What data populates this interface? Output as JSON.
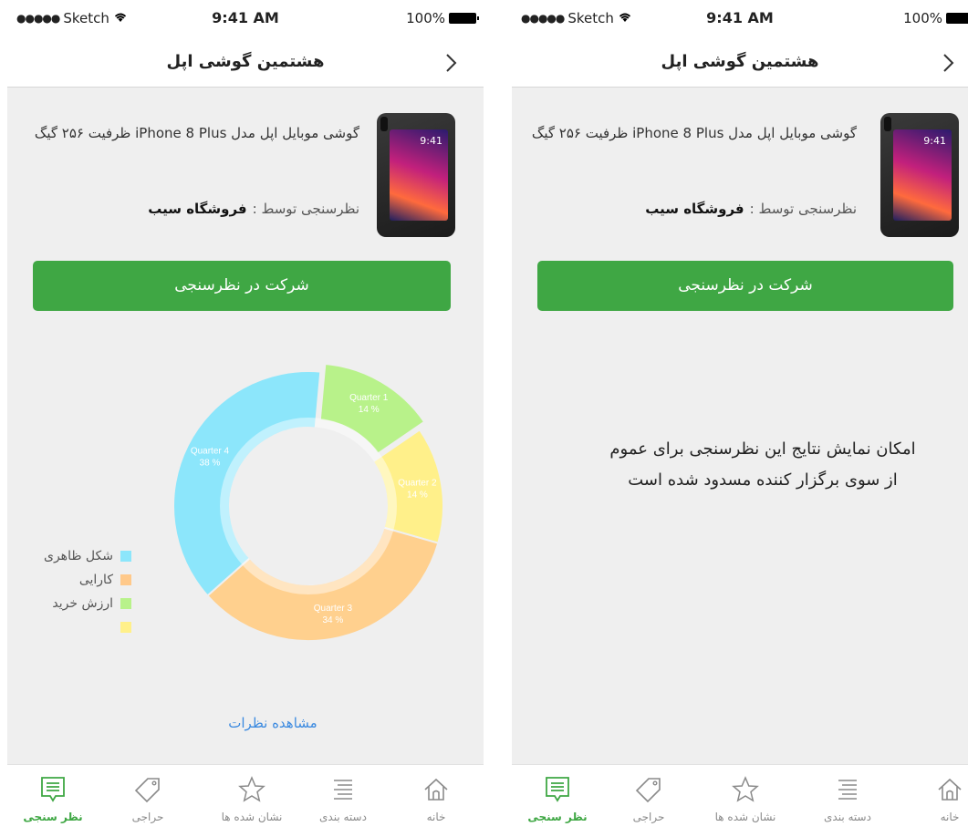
{
  "status_bar": {
    "carrier": "Sketch",
    "time": "9:41 AM",
    "battery": "100%"
  },
  "nav": {
    "title": "هشتمین گوشی اپل"
  },
  "product": {
    "name": "گوشی موبایل اپل مدل iPhone 8 Plus ظرفیت ۲۵۶ گیگ",
    "phone_screen_time": "9:41",
    "surveyor_label": "نظرسنجی توسط :",
    "surveyor_name": "فروشگاه سیب"
  },
  "join_button": "شرکت در نظرسنجی",
  "chart_data": {
    "type": "pie",
    "donut": true,
    "slices": [
      {
        "label": "Quarter 1",
        "percent": 14,
        "color": "#b8f28a"
      },
      {
        "label": "Quarter 2",
        "percent": 14,
        "color": "#fff08a"
      },
      {
        "label": "Quarter 3",
        "percent": 34,
        "color": "#ffd08e"
      },
      {
        "label": "Quarter 4",
        "percent": 38,
        "color": "#8ce6fb"
      }
    ],
    "value_labels": [
      "14 %",
      "14 %",
      "34 %",
      "38 %"
    ],
    "legend": [
      {
        "label": "شکل ظاهری",
        "color": "#8ce6fb"
      },
      {
        "label": "کارایی",
        "color": "#ffc98a"
      },
      {
        "label": "ارزش خرید",
        "color": "#b8f28a"
      },
      {
        "label": "",
        "color": "#fff08a"
      }
    ],
    "legend_position": "left"
  },
  "view_comments": "مشاهده نظرات",
  "restricted_message": {
    "line1": "امکان نمایش نتایج این نظرسنجی برای عموم",
    "line2": "از سوی برگزار کننده مسدود شده است"
  },
  "tabs": [
    {
      "label": "خانه",
      "icon": "home-icon"
    },
    {
      "label": "دسته بندی",
      "icon": "list-icon"
    },
    {
      "label": "نشان شده ها",
      "icon": "star-icon"
    },
    {
      "label": "حراجی",
      "icon": "tag-icon"
    },
    {
      "label": "نظر سنجی",
      "icon": "survey-icon",
      "active": true
    }
  ],
  "colors": {
    "accent": "#3fa744",
    "link": "#3b8ae0"
  }
}
